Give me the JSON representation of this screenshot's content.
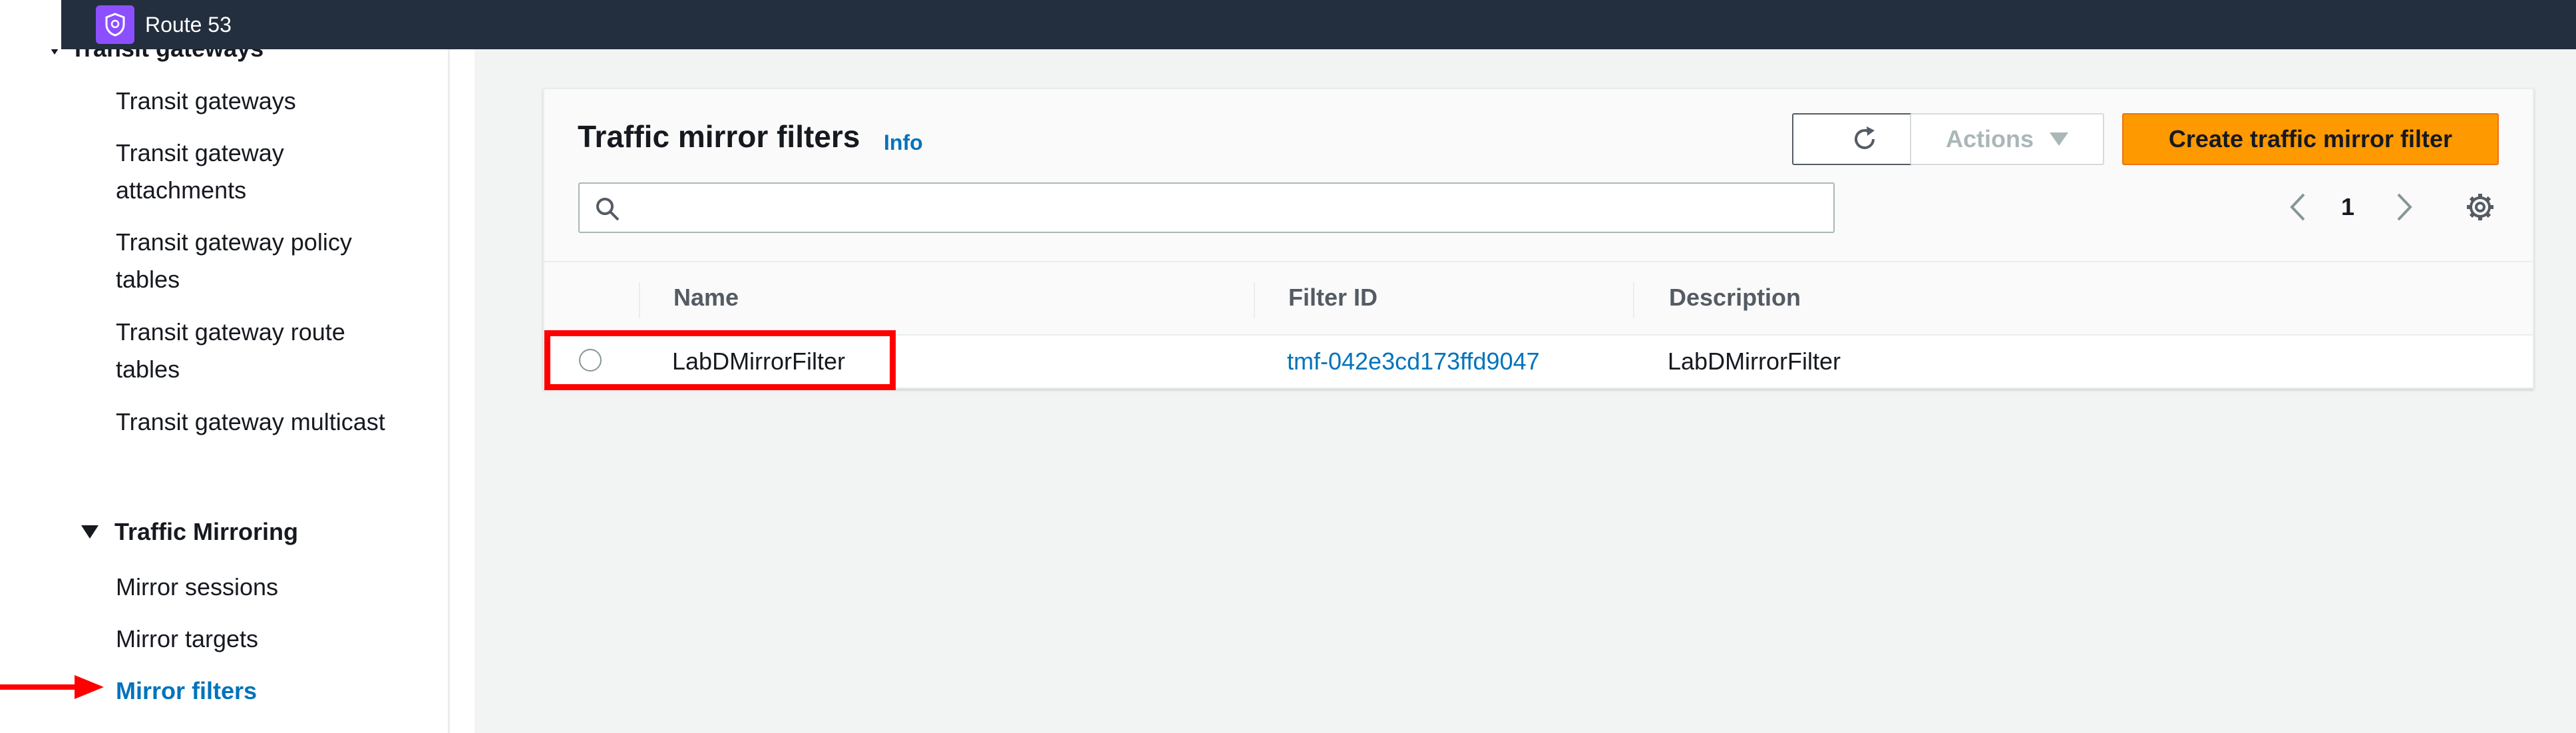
{
  "topbar": {
    "service_name": "Route 53",
    "icon": "route53-shield-icon"
  },
  "sidebar": {
    "cut_section": "Transit gateways",
    "items": [
      {
        "label": "Transit gateways"
      },
      {
        "label": "Transit gateway attachments"
      },
      {
        "label": "Transit gateway policy tables"
      },
      {
        "label": "Transit gateway route tables"
      },
      {
        "label": "Transit gateway multicast"
      }
    ],
    "section": "Traffic Mirroring",
    "mirror_items": [
      {
        "label": "Mirror sessions"
      },
      {
        "label": "Mirror targets"
      },
      {
        "label": "Mirror filters",
        "active": true
      }
    ]
  },
  "panel": {
    "title": "Traffic mirror filters",
    "info": "Info",
    "actions_label": "Actions",
    "create_label": "Create traffic mirror filter",
    "search_placeholder": "",
    "page": "1"
  },
  "table": {
    "columns": [
      "Name",
      "Filter ID",
      "Description"
    ],
    "rows": [
      {
        "name": "LabDMirrorFilter",
        "filter_id": "tmf-042e3cd173ffd9047",
        "description": "LabDMirrorFilter"
      }
    ]
  },
  "colors": {
    "topbar": "#232f3e",
    "accent_orange": "#ff9900",
    "link_blue": "#0073bb",
    "annotation_red": "#ff0000"
  }
}
